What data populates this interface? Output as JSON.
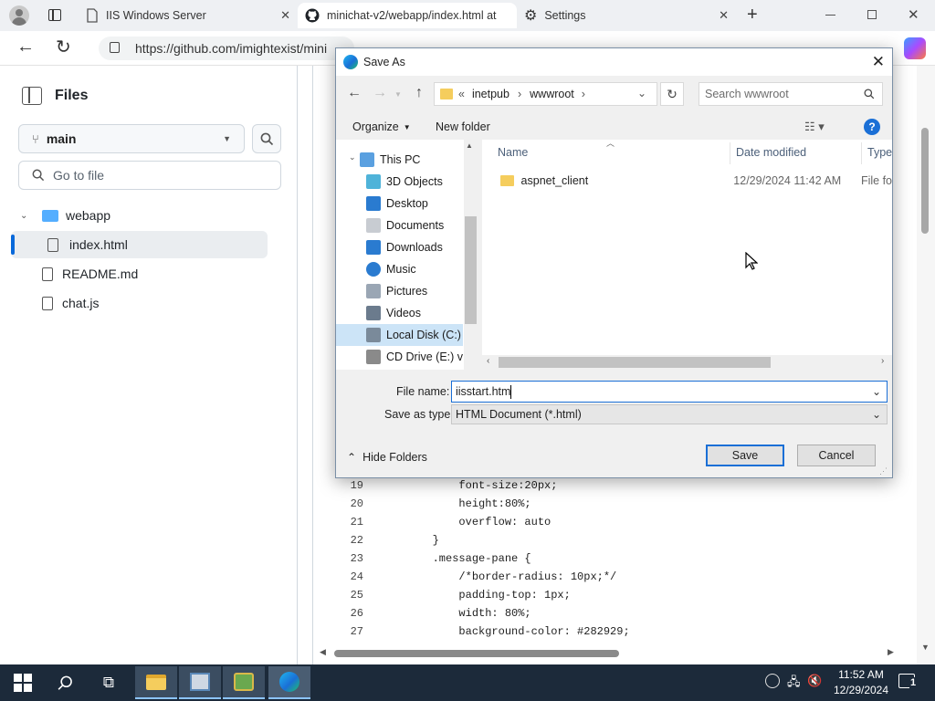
{
  "browser": {
    "tabs": [
      {
        "label": "IIS Windows Server",
        "icon": "page-icon"
      },
      {
        "label": "minichat-v2/webapp/index.html at",
        "icon": "github-icon"
      },
      {
        "label": "Settings",
        "icon": "gear-icon"
      }
    ],
    "url": "https://github.com/imightexist/mini"
  },
  "github": {
    "files_title": "Files",
    "branch": "main",
    "goto_placeholder": "Go to file",
    "tree": [
      {
        "label": "webapp",
        "type": "folder"
      },
      {
        "label": "index.html",
        "type": "file",
        "selected": true
      },
      {
        "label": "README.md",
        "type": "file"
      },
      {
        "label": "chat.js",
        "type": "file"
      }
    ],
    "code_lines": [
      {
        "n": "19",
        "text": "            font-size:20px;"
      },
      {
        "n": "20",
        "text": "            height:80%;"
      },
      {
        "n": "21",
        "text": "            overflow: auto"
      },
      {
        "n": "22",
        "text": "        }"
      },
      {
        "n": "23",
        "text": "        .message-pane {"
      },
      {
        "n": "24",
        "text": "            /*border-radius: 10px;*/"
      },
      {
        "n": "25",
        "text": "            padding-top: 1px;"
      },
      {
        "n": "26",
        "text": "            width: 80%;"
      },
      {
        "n": "27",
        "text": "            background-color: #282929;"
      }
    ]
  },
  "dialog": {
    "title": "Save As",
    "breadcrumb": [
      "inetpub",
      "wwwroot"
    ],
    "search_placeholder": "Search wwwroot",
    "organize": "Organize",
    "new_folder": "New folder",
    "nav_items": [
      "This PC",
      "3D Objects",
      "Desktop",
      "Documents",
      "Downloads",
      "Music",
      "Pictures",
      "Videos",
      "Local Disk (C:)",
      "CD Drive (E:) virt"
    ],
    "columns": {
      "name": "Name",
      "date": "Date modified",
      "type": "Type"
    },
    "files": [
      {
        "name": "aspnet_client",
        "date": "12/29/2024 11:42 AM",
        "type": "File fo"
      }
    ],
    "file_name_label": "File name:",
    "file_name_value": "iisstart.htm",
    "save_type_label": "Save as type:",
    "save_type_value": "HTML Document (*.html)",
    "hide_folders": "Hide Folders",
    "save": "Save",
    "cancel": "Cancel"
  },
  "taskbar": {
    "time": "11:52 AM",
    "date": "12/29/2024",
    "notifications": "1"
  }
}
